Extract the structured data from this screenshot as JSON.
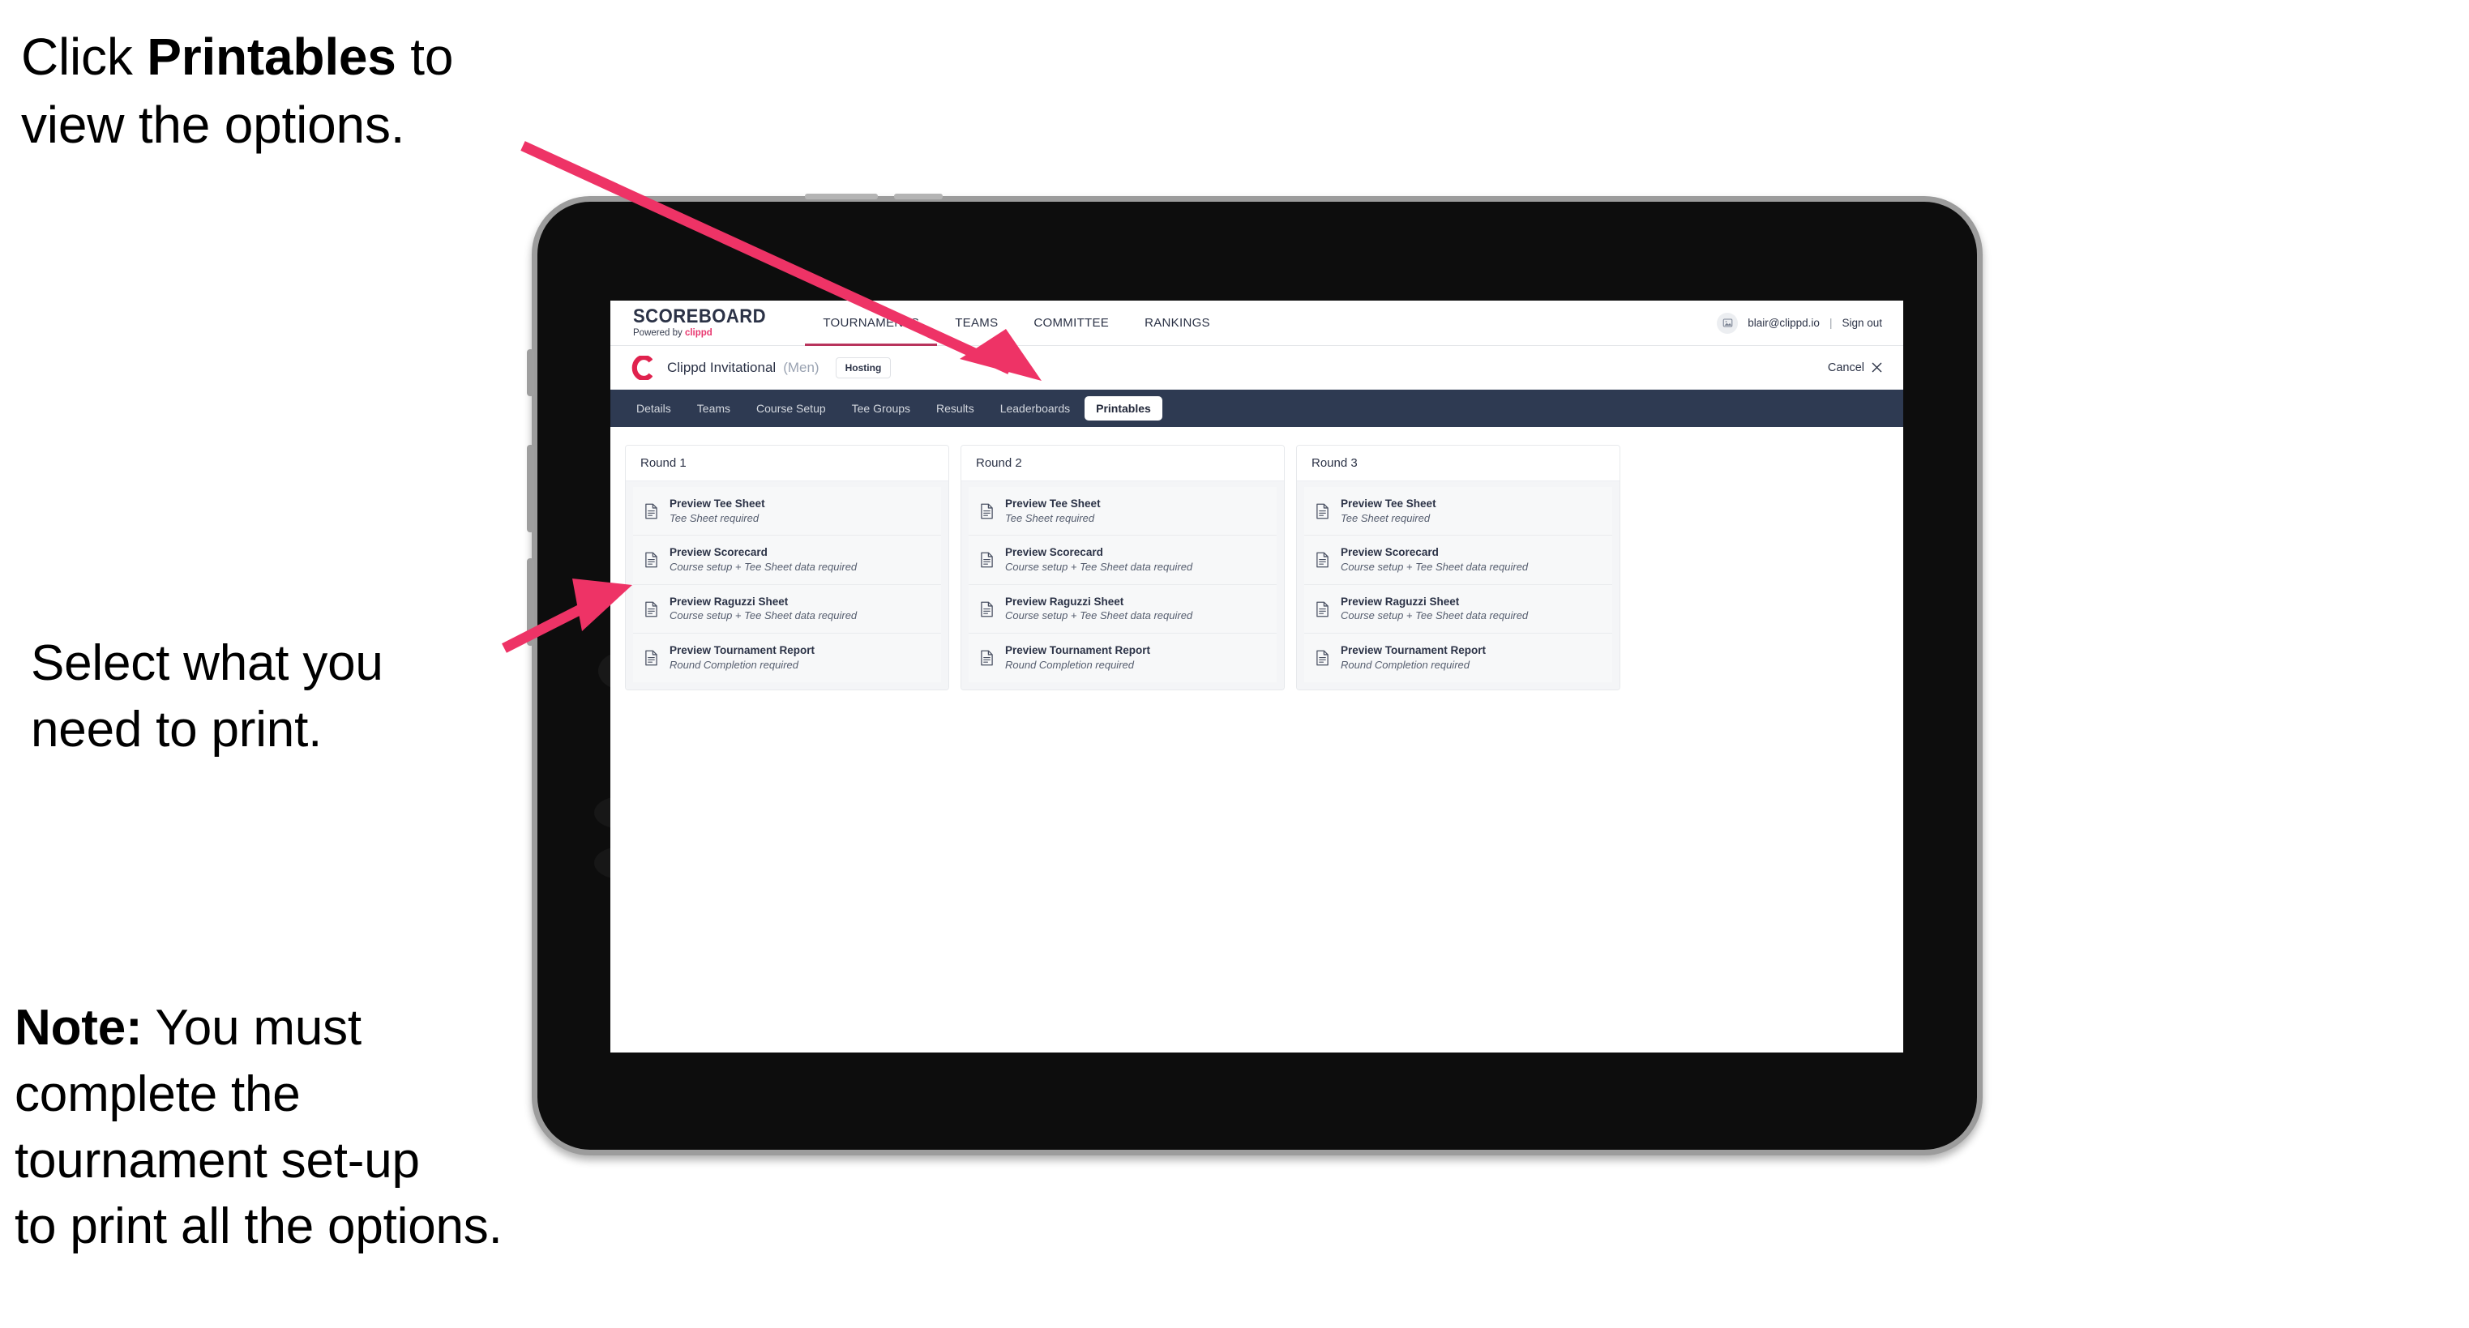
{
  "annotations": {
    "click_printables": {
      "pre": "Click ",
      "bold": "Printables",
      "post": " to\nview the options."
    },
    "select_print": "Select what you\n need to print.",
    "note": {
      "bold": "Note:",
      "rest": " You must\ncomplete the\ntournament set-up\nto print all the options."
    }
  },
  "colors": {
    "accent_pink": "#ee3366",
    "brand_pink": "#e8376f",
    "tabbar_navy": "#2e3a52",
    "text_dark": "#2b3246"
  },
  "app": {
    "brand": {
      "word": "SCOREBOARD",
      "powered_prefix": "Powered by ",
      "powered_brand": "clippd"
    },
    "nav_links": [
      {
        "label": "TOURNAMENTS",
        "active": true
      },
      {
        "label": "TEAMS",
        "active": false
      },
      {
        "label": "COMMITTEE",
        "active": false
      },
      {
        "label": "RANKINGS",
        "active": false
      }
    ],
    "account": {
      "avatar_icon": "image-icon",
      "email": "blair@clippd.io",
      "separator": "|",
      "sign_out": "Sign out"
    },
    "tournament": {
      "logo_letter": "C",
      "name": "Clippd Invitational",
      "gender": "(Men)",
      "status_badge": "Hosting",
      "cancel_label": "Cancel",
      "cancel_icon": "close-icon"
    },
    "tabs": [
      {
        "label": "Details",
        "active": false
      },
      {
        "label": "Teams",
        "active": false
      },
      {
        "label": "Course Setup",
        "active": false
      },
      {
        "label": "Tee Groups",
        "active": false
      },
      {
        "label": "Results",
        "active": false
      },
      {
        "label": "Leaderboards",
        "active": false
      },
      {
        "label": "Printables",
        "active": true
      }
    ],
    "rounds": [
      {
        "title": "Round 1",
        "items": [
          {
            "icon": "document-icon",
            "title": "Preview Tee Sheet",
            "subtitle": "Tee Sheet required"
          },
          {
            "icon": "document-icon",
            "title": "Preview Scorecard",
            "subtitle": "Course setup + Tee Sheet data required"
          },
          {
            "icon": "document-icon",
            "title": "Preview Raguzzi Sheet",
            "subtitle": "Course setup + Tee Sheet data required"
          },
          {
            "icon": "document-icon",
            "title": "Preview Tournament Report",
            "subtitle": "Round Completion required"
          }
        ]
      },
      {
        "title": "Round 2",
        "items": [
          {
            "icon": "document-icon",
            "title": "Preview Tee Sheet",
            "subtitle": "Tee Sheet required"
          },
          {
            "icon": "document-icon",
            "title": "Preview Scorecard",
            "subtitle": "Course setup + Tee Sheet data required"
          },
          {
            "icon": "document-icon",
            "title": "Preview Raguzzi Sheet",
            "subtitle": "Course setup + Tee Sheet data required"
          },
          {
            "icon": "document-icon",
            "title": "Preview Tournament Report",
            "subtitle": "Round Completion required"
          }
        ]
      },
      {
        "title": "Round 3",
        "items": [
          {
            "icon": "document-icon",
            "title": "Preview Tee Sheet",
            "subtitle": "Tee Sheet required"
          },
          {
            "icon": "document-icon",
            "title": "Preview Scorecard",
            "subtitle": "Course setup + Tee Sheet data required"
          },
          {
            "icon": "document-icon",
            "title": "Preview Raguzzi Sheet",
            "subtitle": "Course setup + Tee Sheet data required"
          },
          {
            "icon": "document-icon",
            "title": "Preview Tournament Report",
            "subtitle": "Round Completion required"
          }
        ]
      }
    ]
  }
}
